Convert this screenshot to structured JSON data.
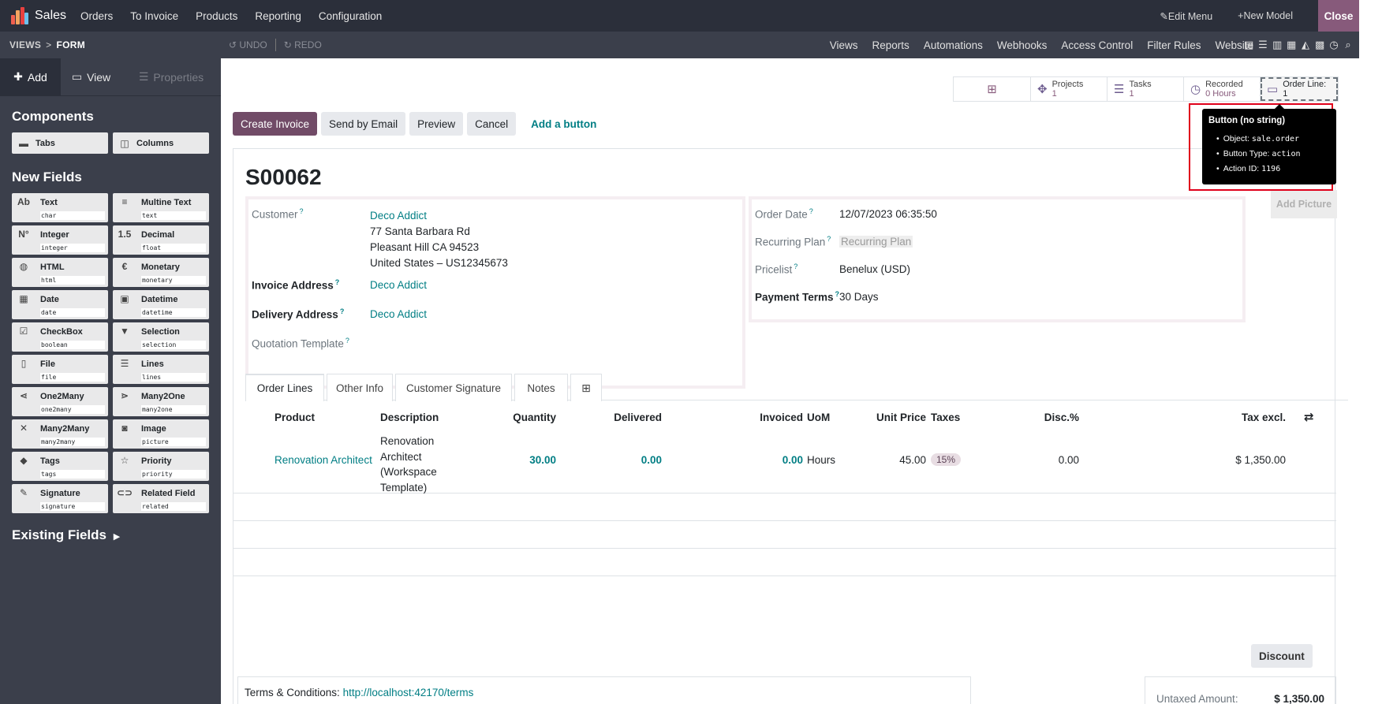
{
  "topnav": {
    "app_name": "Sales",
    "menu": [
      "Orders",
      "To Invoice",
      "Products",
      "Reporting",
      "Configuration"
    ],
    "edit_menu": "Edit Menu",
    "new_model": "New Model",
    "close": "Close",
    "brand_color": "#875a7b"
  },
  "subbar": {
    "crumb_root": "VIEWS",
    "crumb_sep": ">",
    "crumb_current": "FORM",
    "undo": "UNDO",
    "redo": "REDO",
    "links": [
      "Views",
      "Reports",
      "Automations",
      "Webhooks",
      "Access Control",
      "Filter Rules",
      "Website"
    ]
  },
  "sidebar": {
    "tabs": {
      "add": "Add",
      "view": "View",
      "properties": "Properties"
    },
    "components_title": "Components",
    "components": [
      {
        "label": "Tabs",
        "icon": "tabs-icon",
        "glyph": "▬"
      },
      {
        "label": "Columns",
        "icon": "columns-icon",
        "glyph": "◫"
      }
    ],
    "new_fields_title": "New Fields",
    "fields": [
      {
        "label": "Text",
        "tech": "char",
        "icon": "text-icon",
        "glyph": "Ab"
      },
      {
        "label": "Multine Text",
        "tech": "text",
        "icon": "multiline-icon",
        "glyph": "≡"
      },
      {
        "label": "Integer",
        "tech": "integer",
        "icon": "integer-icon",
        "glyph": "N°"
      },
      {
        "label": "Decimal",
        "tech": "float",
        "icon": "decimal-icon",
        "glyph": "1.5"
      },
      {
        "label": "HTML",
        "tech": "html",
        "icon": "globe-icon",
        "glyph": "◍"
      },
      {
        "label": "Monetary",
        "tech": "monetary",
        "icon": "euro-icon",
        "glyph": "€"
      },
      {
        "label": "Date",
        "tech": "date",
        "icon": "calendar-icon",
        "glyph": "▦"
      },
      {
        "label": "Datetime",
        "tech": "datetime",
        "icon": "calendar-clock-icon",
        "glyph": "▣"
      },
      {
        "label": "CheckBox",
        "tech": "boolean",
        "icon": "checkbox-icon",
        "glyph": "☑"
      },
      {
        "label": "Selection",
        "tech": "selection",
        "icon": "caret-down-icon",
        "glyph": "▼"
      },
      {
        "label": "File",
        "tech": "file",
        "icon": "file-icon",
        "glyph": "▯"
      },
      {
        "label": "Lines",
        "tech": "lines",
        "icon": "list-icon",
        "glyph": "☰"
      },
      {
        "label": "One2Many",
        "tech": "one2many",
        "icon": "one2many-icon",
        "glyph": "⋖"
      },
      {
        "label": "Many2One",
        "tech": "many2one",
        "icon": "many2one-icon",
        "glyph": "⋗"
      },
      {
        "label": "Many2Many",
        "tech": "many2many",
        "icon": "many2many-icon",
        "glyph": "✕"
      },
      {
        "label": "Image",
        "tech": "picture",
        "icon": "camera-icon",
        "glyph": "◙"
      },
      {
        "label": "Tags",
        "tech": "tags",
        "icon": "tag-icon",
        "glyph": "◆"
      },
      {
        "label": "Priority",
        "tech": "priority",
        "icon": "star-icon",
        "glyph": "☆"
      },
      {
        "label": "Signature",
        "tech": "signature",
        "icon": "signature-icon",
        "glyph": "✎"
      },
      {
        "label": "Related Field",
        "tech": "related",
        "icon": "link-icon",
        "glyph": "⊂⊃"
      }
    ],
    "existing_fields": "Existing Fields"
  },
  "smart_buttons": {
    "projects_label": "Projects",
    "projects_value": "1",
    "tasks_label": "Tasks",
    "tasks_value": "1",
    "recorded_label": "Recorded",
    "recorded_value": "0 Hours",
    "order_line_label": "Order Line:",
    "order_line_value": "1"
  },
  "actions": {
    "create_invoice": "Create Invoice",
    "send_email": "Send by Email",
    "preview": "Preview",
    "cancel": "Cancel",
    "add_button": "Add a button"
  },
  "form": {
    "title": "S00062",
    "add_picture": "Add Picture",
    "customer_label": "Customer",
    "customer_name": "Deco Addict",
    "customer_address_1": "77 Santa Barbara Rd",
    "customer_address_2": "Pleasant Hill CA 94523",
    "customer_address_3": "United States – US12345673",
    "invoice_address_label": "Invoice Address",
    "invoice_address": "Deco Addict",
    "delivery_address_label": "Delivery Address",
    "delivery_address": "Deco Addict",
    "quotation_template_label": "Quotation Template",
    "order_date_label": "Order Date",
    "order_date": "12/07/2023 06:35:50",
    "recurring_plan_label": "Recurring Plan",
    "recurring_plan_placeholder": "Recurring Plan",
    "pricelist_label": "Pricelist",
    "pricelist": "Benelux (USD)",
    "payment_terms_label": "Payment Terms",
    "payment_terms": "30 Days",
    "help_mark": "?"
  },
  "tabs": [
    "Order Lines",
    "Other Info",
    "Customer Signature",
    "Notes"
  ],
  "order_lines": {
    "columns": [
      "Product",
      "Description",
      "Quantity",
      "Delivered",
      "Invoiced",
      "UoM",
      "Unit Price",
      "Taxes",
      "Disc.%",
      "Tax excl."
    ],
    "rows": [
      {
        "product": "Renovation Architect",
        "description": [
          "Renovation",
          "Architect",
          "(Workspace",
          "Template)"
        ],
        "quantity": "30.00",
        "delivered": "0.00",
        "invoiced": "0.00",
        "uom": "Hours",
        "unit_price": "45.00",
        "taxes": "15%",
        "discount": "0.00",
        "subtotal": "$ 1,350.00"
      }
    ]
  },
  "discount_button": "Discount",
  "terms": {
    "label": "Terms & Conditions:",
    "link": "http://localhost:42170/terms"
  },
  "totals": {
    "untaxed_label": "Untaxed Amount:",
    "untaxed_value": "$ 1,350.00"
  },
  "tooltip": {
    "title": "Button (no string)",
    "object_label": "Object:",
    "object_value": "sale.order",
    "type_label": "Button Type:",
    "type_value": "action",
    "action_label": "Action ID:",
    "action_value": "1196"
  }
}
